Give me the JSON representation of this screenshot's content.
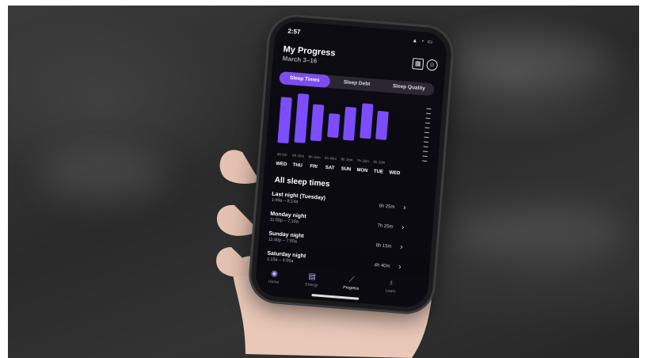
{
  "status_bar": {
    "time": "2:57",
    "icons": "▲ ◔ ▭"
  },
  "header": {
    "title": "My Progress",
    "subtitle": "March 3–16",
    "gift_icon": "gift-icon",
    "profile_icon": "profile-icon"
  },
  "tabs": [
    {
      "label": "Sleep Times",
      "active": true
    },
    {
      "label": "Sleep Debt",
      "active": false
    },
    {
      "label": "Sleep Quality",
      "active": false
    }
  ],
  "chart_data": {
    "type": "bar",
    "categories": [
      "WED",
      "THU",
      "FRI",
      "SAT",
      "SUN",
      "MON",
      "TUE",
      "WED"
    ],
    "durations": [
      "8h 0m",
      "8h 20m",
      "8h 15m",
      "6h 40m",
      "8h 15m",
      "7h 25m",
      "6h 10m",
      ""
    ],
    "accent": "#7c4dff"
  },
  "section": {
    "title": "All sleep times"
  },
  "sleep_list": [
    {
      "name": "Last night (Tuesday)",
      "time": "1:49a – 8:14a",
      "duration": "6h 25m"
    },
    {
      "name": "Monday night",
      "time": "11:50p – 7:15a",
      "duration": "7h 25m"
    },
    {
      "name": "Sunday night",
      "time": "11:40p – 7:55a",
      "duration": "8h 15m"
    },
    {
      "name": "Saturday night",
      "time": "1:15a – 4:55a",
      "duration": "4h 40m"
    }
  ],
  "nav": [
    {
      "label": "Home",
      "icon": "home-icon",
      "active": false
    },
    {
      "label": "Energy",
      "icon": "energy-icon",
      "active": false
    },
    {
      "label": "Progress",
      "icon": "progress-icon",
      "active": true
    },
    {
      "label": "Learn",
      "icon": "learn-icon",
      "active": false
    }
  ]
}
